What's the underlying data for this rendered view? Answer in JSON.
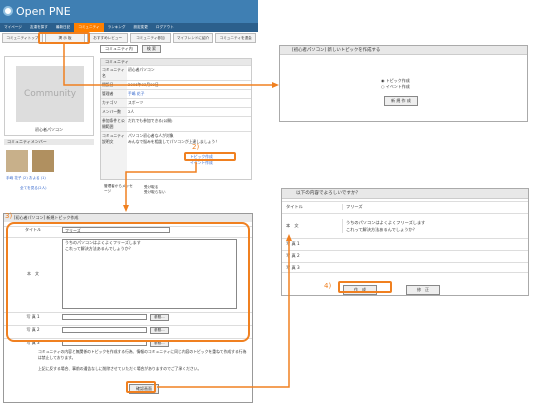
{
  "app": {
    "logo": "Open PNE"
  },
  "topnav": [
    "マイページ",
    "友達を探す",
    "最新日記",
    "コミュニティ",
    "ランキング",
    "設定変更",
    "ログアウト"
  ],
  "subnav": [
    "コミュニティトップ",
    "掲 示 板",
    "おすすめレビュー",
    "コミュニティ参加",
    "マイフレンドに紹介",
    "コミュニティを退会"
  ],
  "community": {
    "select": "コミュニティ内",
    "search": "検 索",
    "photo_label": "Community",
    "name": "初心者パソコン",
    "info_header": "コミュニティ",
    "rows": [
      {
        "k": "コミュニティ名",
        "v": "初心者パソコン"
      },
      {
        "k": "開設日",
        "v": "2006年03月09日"
      },
      {
        "k": "管理者",
        "v": "手嶋 花子"
      },
      {
        "k": "カテゴリ",
        "v": "スポーツ"
      },
      {
        "k": "メンバー数",
        "v": "2人"
      },
      {
        "k": "参加条件と公開範囲",
        "v": "だれでも参加できる(公開)"
      },
      {
        "k": "コミュニティ説明文",
        "v": "パソコン初心者な人が対象\nみんなで悩みを相談してパソコンが上達しましょう！"
      }
    ],
    "members_header": "コミュニティメンバー",
    "member_names": "手嶋 花子 (2)   およる (1)",
    "member_all": "全てを見る(2人)",
    "links": [
      "トピック作成",
      "イベント作成"
    ],
    "notify_label": "管理者からメッセージ",
    "notify_options": [
      "受け取る",
      "受け取らない"
    ]
  },
  "labels": {
    "step2": "2)",
    "step3": "3)",
    "step4": "4)"
  },
  "form3": {
    "title": "[初心者パソコン] 新規トピック作成",
    "title_label": "タイトル",
    "title_value": "フリーズ",
    "body_label": "本　文",
    "body_value": "うちのパソコンはよくよくフリーズします\nこれって解決方法あるんでしょうか？",
    "photo1": "写 真 1",
    "photo2": "写 真 2",
    "photo3": "写 真 3",
    "browse": "参照...",
    "note": "コミュニティの内容と無関係のトピックを作成する行為、情報のコミュニティに同じ内容のトピックを重ねて作成する行為は禁止しております。\n\n上記に反する場合、事前の通告なしに削除させていただく場合がありますのでご了承ください。",
    "confirm": "確認画面"
  },
  "panelA": {
    "title": "[初心者パソコン] 新しいトピックを作成する",
    "radios": [
      "トピック作成",
      "イベント作成"
    ],
    "button": "新 規 作 成"
  },
  "panelB": {
    "title": "以下の内容でよろしいですか？",
    "rows": [
      {
        "k": "タイトル",
        "v": "フリーズ"
      },
      {
        "k": "本　文",
        "v": "うちのパソコンはよくよくフリーズします\nこれって解決方法あるんでしょうか？"
      },
      {
        "k": "写 真 1",
        "v": ""
      },
      {
        "k": "写 真 2",
        "v": ""
      },
      {
        "k": "写 真 3",
        "v": ""
      }
    ],
    "create": "作　成",
    "fix": "修　正"
  }
}
